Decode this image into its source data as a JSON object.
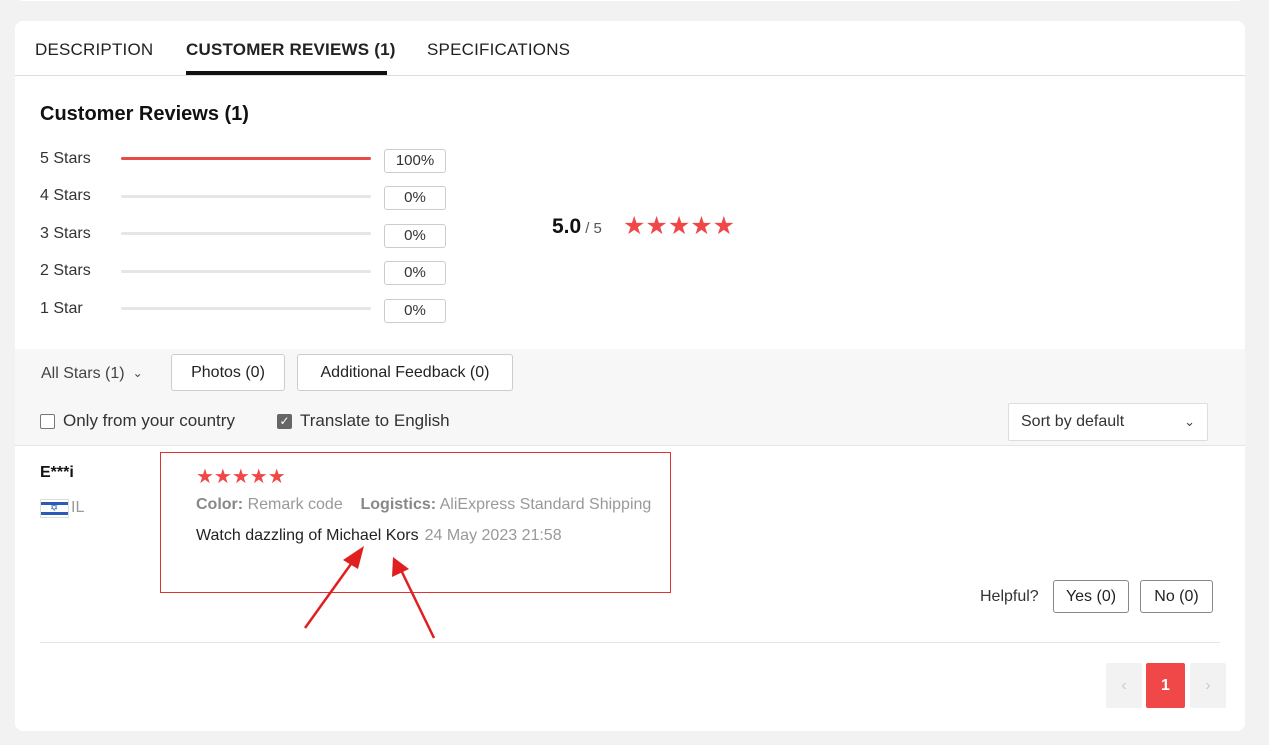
{
  "tabs": [
    {
      "label": "DESCRIPTION",
      "active": false
    },
    {
      "label": "CUSTOMER REVIEWS (1)",
      "active": true
    },
    {
      "label": "SPECIFICATIONS",
      "active": false
    }
  ],
  "reviews_summary": {
    "title": "Customer Reviews (1)",
    "rows": [
      {
        "label": "5 Stars",
        "percent": "100%",
        "fill": 1.0
      },
      {
        "label": "4 Stars",
        "percent": "0%",
        "fill": 0
      },
      {
        "label": "3 Stars",
        "percent": "0%",
        "fill": 0
      },
      {
        "label": "2 Stars",
        "percent": "0%",
        "fill": 0
      },
      {
        "label": "1 Star",
        "percent": "0%",
        "fill": 0
      }
    ],
    "average": "5.0",
    "average_max": "/ 5",
    "average_stars": "★★★★★",
    "star_color": "#f04848"
  },
  "filters": {
    "all_stars": "All Stars (1)",
    "photos": "Photos (0)",
    "additional": "Additional Feedback (0)",
    "only_country": {
      "label": "Only from your country",
      "checked": false
    },
    "translate": {
      "label": "Translate to English",
      "checked": true
    },
    "sort": "Sort by default"
  },
  "review": {
    "name": "E***i",
    "country": "IL",
    "stars": "★★★★★",
    "color_label": "Color:",
    "color_value": "Remark code",
    "logistics_label": "Logistics:",
    "logistics_value": "AliExpress Standard Shipping",
    "text": "Watch dazzling of Michael Kors",
    "date": "24 May 2023 21:58",
    "helpful_label": "Helpful?",
    "yes": "Yes (0)",
    "no": "No (0)"
  },
  "pagination": {
    "prev": "‹",
    "current": "1",
    "next": "›"
  },
  "colors": {
    "accent": "#f04848",
    "annotation": "#e02020"
  }
}
